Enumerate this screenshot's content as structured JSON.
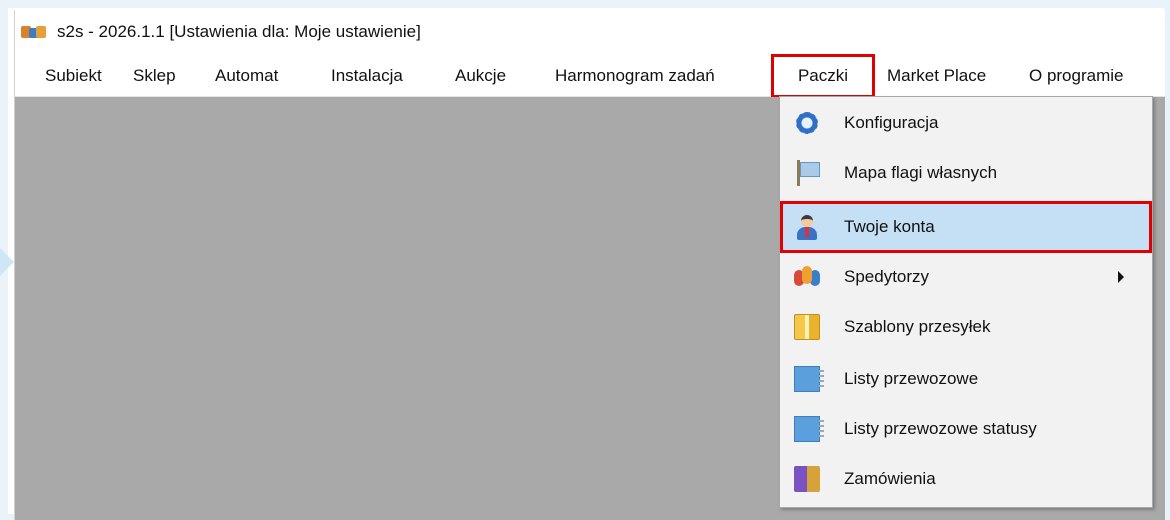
{
  "window": {
    "title": "s2s - 2026.1.1 [Ustawienia dla: Moje ustawienie]",
    "icon": "app-logo-icon"
  },
  "menubar": {
    "items": [
      {
        "label": "Subiekt"
      },
      {
        "label": "Sklep"
      },
      {
        "label": "Automat"
      },
      {
        "label": "Instalacja"
      },
      {
        "label": "Aukcje"
      },
      {
        "label": "Harmonogram zadań"
      },
      {
        "label": "Paczki",
        "active": true,
        "highlighted": true
      },
      {
        "label": "Market Place"
      },
      {
        "label": "O programie"
      }
    ]
  },
  "dropdown": {
    "items": [
      {
        "label": "Konfiguracja",
        "icon": "gear-icon"
      },
      {
        "label": "Mapa flagi własnych",
        "icon": "flag-icon"
      },
      {
        "label": "Twoje konta",
        "icon": "user-account-icon",
        "selected": true,
        "highlighted": true
      },
      {
        "label": "Spedytorzy",
        "icon": "group-icon",
        "has_submenu": true
      },
      {
        "label": "Szablony przesyłek",
        "icon": "package-icon"
      },
      {
        "label": "Listy przewozowe",
        "icon": "document-icon"
      },
      {
        "label": "Listy przewozowe statusy",
        "icon": "document-icon"
      },
      {
        "label": "Zamówienia",
        "icon": "orders-icon"
      }
    ]
  },
  "colors": {
    "highlight_border": "#e00000",
    "selected_background": "#c5dff5",
    "workspace": "#a9a9a9",
    "menu_background": "#f2f2f2"
  }
}
